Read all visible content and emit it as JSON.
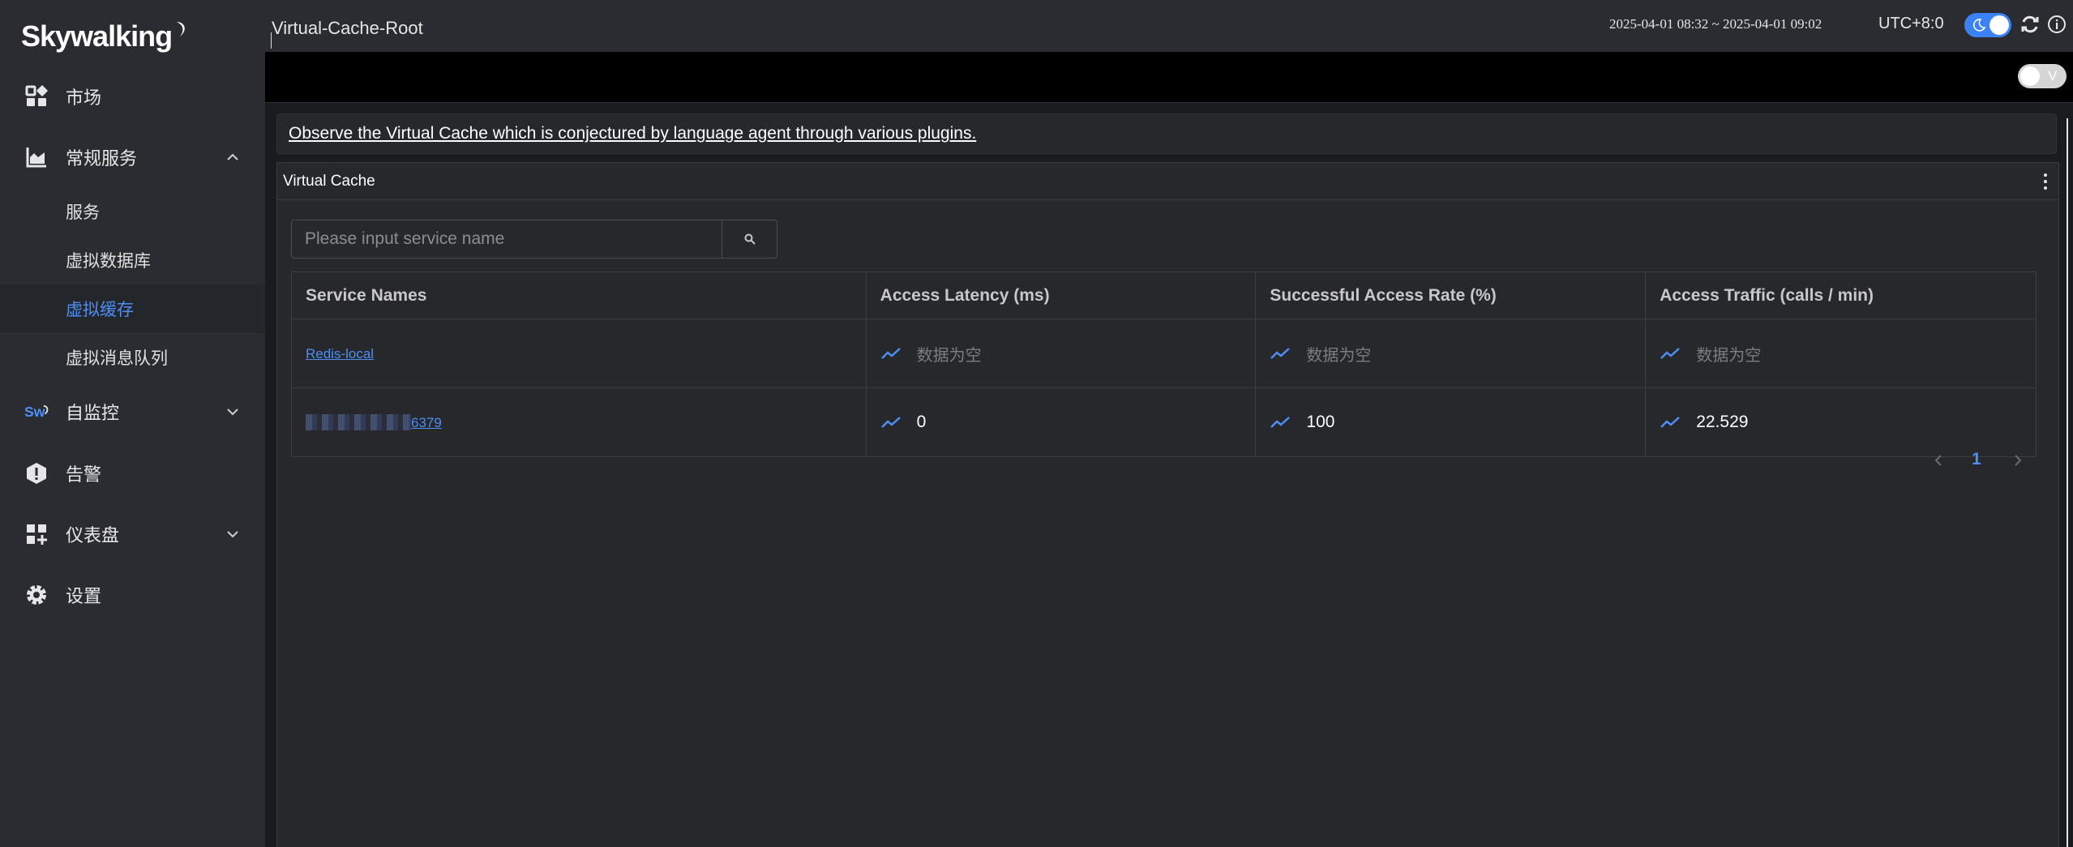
{
  "brand": {
    "logo_text": "Skywalking"
  },
  "sidebar": {
    "items": [
      {
        "label": "市场",
        "icon": "dashboard-grid-icon"
      },
      {
        "label": "常规服务",
        "icon": "chart-icon",
        "expanded": true
      },
      {
        "label": "自监控",
        "icon": "sw-logo-icon",
        "expanded": false
      },
      {
        "label": "告警",
        "icon": "alert-hexagon-icon"
      },
      {
        "label": "仪表盘",
        "icon": "dashboard-add-icon",
        "expanded": false
      },
      {
        "label": "设置",
        "icon": "gear-icon"
      }
    ],
    "sub_items": [
      {
        "label": "服务"
      },
      {
        "label": "虚拟数据库"
      },
      {
        "label": "虚拟缓存",
        "active": true
      },
      {
        "label": "虚拟消息队列"
      }
    ]
  },
  "header": {
    "title": "Virtual-Cache-Root",
    "time_range": "2025-04-01 08:32 ~ 2025-04-01 09:02",
    "timezone": "UTC+8:0",
    "theme_toggle": "dark"
  },
  "toolbar": {
    "v_toggle_label": "V"
  },
  "description": {
    "text": "Observe the Virtual Cache which is conjectured by language agent through various plugins."
  },
  "panel": {
    "title": "Virtual Cache",
    "search": {
      "placeholder": "Please input service name",
      "value": ""
    },
    "columns": [
      "Service Names",
      "Access Latency (ms)",
      "Successful Access Rate (%)",
      "Access Traffic (calls / min)"
    ],
    "rows": [
      {
        "name": "Redis-local",
        "latency": "数据为空",
        "success_rate": "数据为空",
        "traffic": "数据为空",
        "empty": true
      },
      {
        "name": "6379",
        "latency": "0",
        "success_rate": "100",
        "traffic": "22.529",
        "empty": false,
        "name_obscured": true
      }
    ],
    "pagination": {
      "current_page": "1"
    }
  },
  "colors": {
    "accent": "#4e8ef5",
    "sidebar_bg": "#2a2c31",
    "content_bg": "#1a1b1e"
  }
}
